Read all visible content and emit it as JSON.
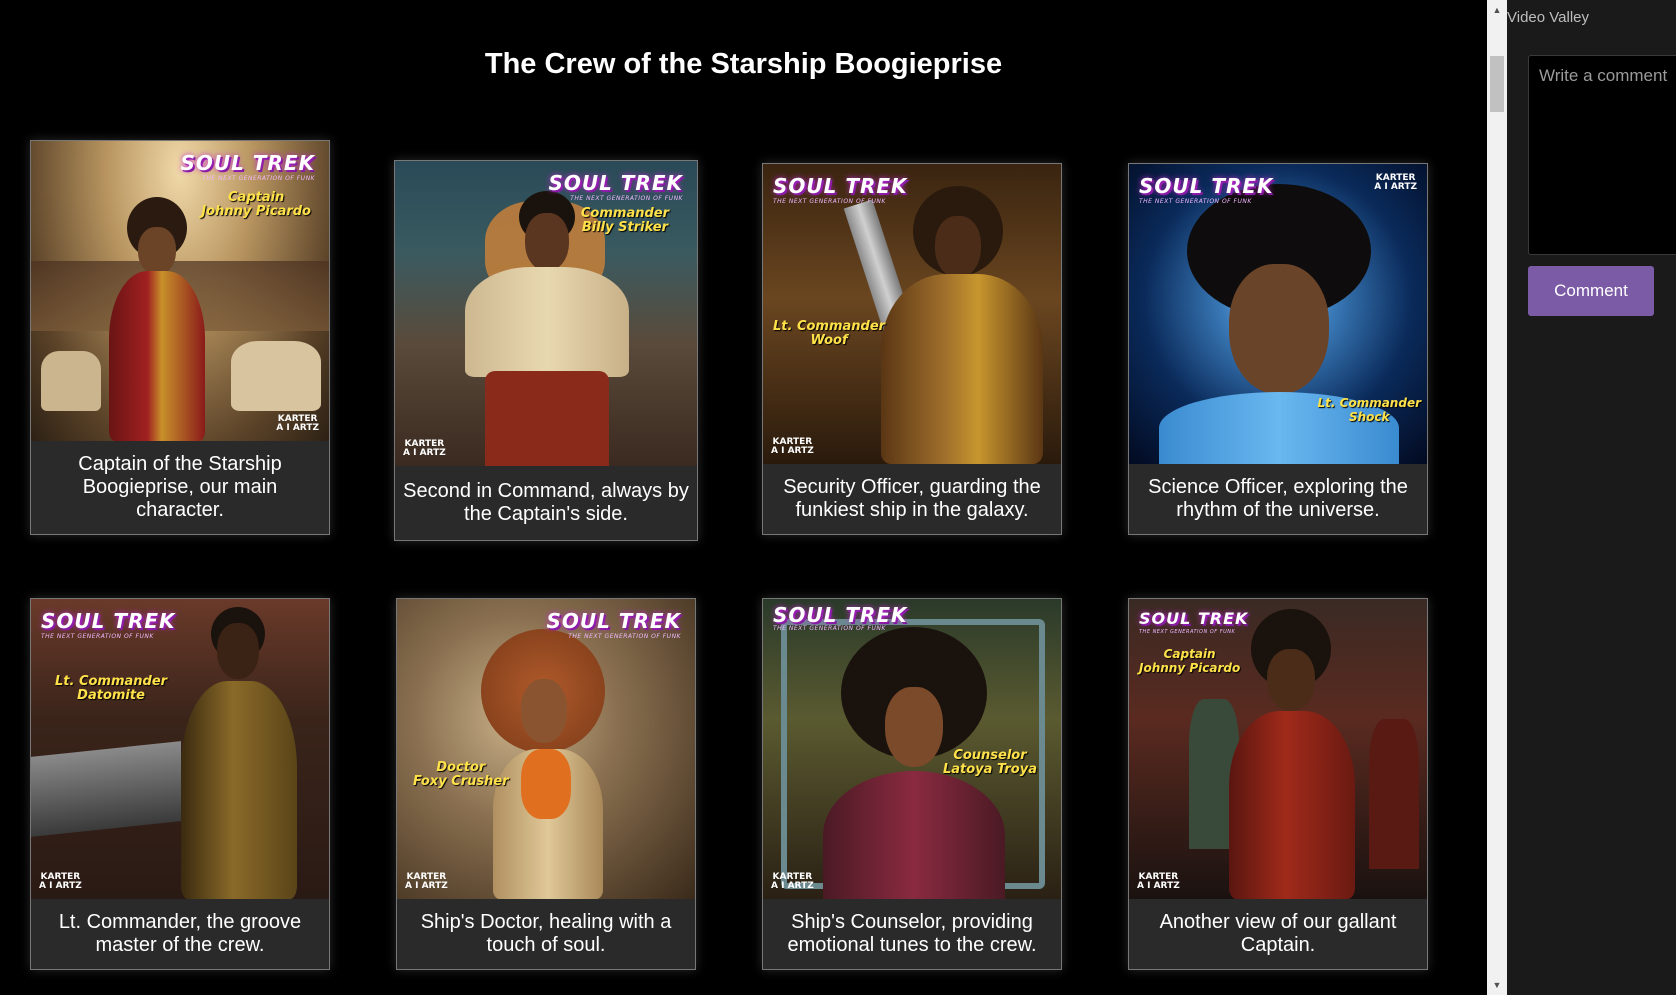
{
  "page": {
    "title": "The Crew of the Starship Boogieprise"
  },
  "cards": [
    {
      "logo": "SOUL TREK",
      "tagline": "THE NEXT GENERATION OF FUNK",
      "name_line1": "Captain",
      "name_line2": "Johnny Picardo",
      "brand_line1": "KARTER",
      "brand_line2": "A I ARTZ",
      "caption": "Captain of the Starship Boogieprise, our main character."
    },
    {
      "logo": "SOUL TREK",
      "tagline": "THE NEXT GENERATION OF FUNK",
      "name_line1": "Commander",
      "name_line2": "Billy Striker",
      "brand_line1": "KARTER",
      "brand_line2": "A I ARTZ",
      "caption": "Second in Command, always by the Captain's side."
    },
    {
      "logo": "SOUL TREK",
      "tagline": "THE NEXT GENERATION OF FUNK",
      "name_line1": "Lt. Commander",
      "name_line2": "Woof",
      "brand_line1": "KARTER",
      "brand_line2": "A I ARTZ",
      "caption": "Security Officer, guarding the funkiest ship in the galaxy."
    },
    {
      "logo": "SOUL TREK",
      "tagline": "THE NEXT GENERATION OF FUNK",
      "name_line1": "Lt. Commander",
      "name_line2": "Shock",
      "brand_line1": "KARTER",
      "brand_line2": "A I ARTZ",
      "caption": "Science Officer, exploring the rhythm of the universe."
    },
    {
      "logo": "SOUL TREK",
      "tagline": "THE NEXT GENERATION OF FUNK",
      "name_line1": "Lt. Commander",
      "name_line2": "Datomite",
      "brand_line1": "KARTER",
      "brand_line2": "A I ARTZ",
      "caption": "Lt. Commander, the groove master of the crew."
    },
    {
      "logo": "SOUL TREK",
      "tagline": "THE NEXT GENERATION OF FUNK",
      "name_line1": "Doctor",
      "name_line2": "Foxy Crusher",
      "brand_line1": "KARTER",
      "brand_line2": "A I ARTZ",
      "caption": "Ship's Doctor, healing with a touch of soul."
    },
    {
      "logo": "SOUL TREK",
      "tagline": "THE NEXT GENERATION OF FUNK",
      "name_line1": "Counselor",
      "name_line2": "Latoya Troya",
      "brand_line1": "KARTER",
      "brand_line2": "A I ARTZ",
      "caption": "Ship's Counselor, providing emotional tunes to the crew."
    },
    {
      "logo": "SOUL TREK",
      "tagline": "THE NEXT GENERATION OF FUNK",
      "name_line1": "Captain",
      "name_line2": "Johnny Picardo",
      "brand_line1": "KARTER",
      "brand_line2": "A I ARTZ",
      "caption": "Another view of our gallant Captain."
    }
  ],
  "panel": {
    "title": "Video Valley",
    "comment_placeholder": "Write a comment",
    "comment_button": "Comment"
  },
  "colors": {
    "accent": "#7b5aa6",
    "name_label": "#ffe24a",
    "logo_glow": "#c028d0"
  }
}
